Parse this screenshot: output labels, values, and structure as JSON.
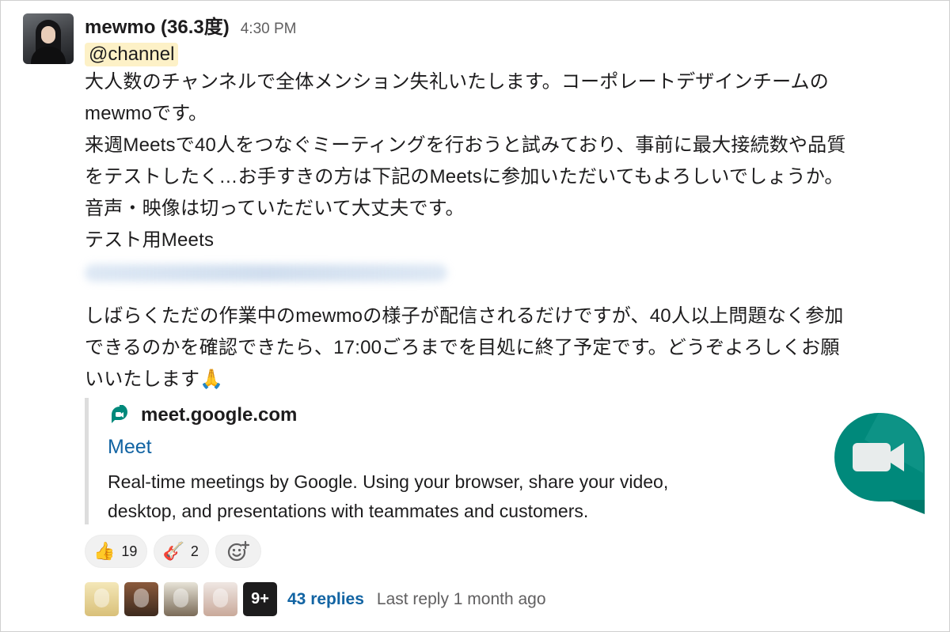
{
  "message": {
    "username": "mewmo (36.3度)",
    "timestamp": "4:30 PM",
    "mention": "@channel",
    "paragraph1": [
      "大人数のチャンネルで全体メンション失礼いたします。コーポレートデザインチームの",
      "mewmoです。",
      "来週Meetsで40人をつなぐミーティングを行おうと試みており、事前に最大接続数や品質",
      "をテストしたく…お手すきの方は下記のMeetsに参加いただいてもよろしいでしょうか。",
      "音声・映像は切っていただいて大丈夫です。",
      "テスト用Meets"
    ],
    "paragraph2": [
      "しばらくただの作業中のmewmoの様子が配信されるだけですが、40人以上問題なく参加",
      "できるのかを確認できたら、17:00ごろまでを目処に終了予定です。どうぞよろしくお願",
      "いいたします🙏"
    ]
  },
  "unfurl": {
    "site": "meet.google.com",
    "title": "Meet",
    "description_line1": "Real-time meetings by Google. Using your browser, share your video,",
    "description_line2": "desktop, and presentations with teammates and customers.",
    "logo_icon": "google-meet-logo-icon"
  },
  "reactions": [
    {
      "emoji": "👍",
      "icon": "thumbs-up-icon",
      "count": "19"
    },
    {
      "emoji": "🎸",
      "icon": "guitar-icon",
      "count": "2"
    }
  ],
  "add_reaction_icon": "add-reaction-icon",
  "thread": {
    "more_label": "9+",
    "replies_label": "43 replies",
    "last_reply": "Last reply 1 month ago"
  },
  "colors": {
    "link": "#1264a3",
    "mention_bg": "#fdf1c7",
    "meet_green": "#00897b"
  }
}
